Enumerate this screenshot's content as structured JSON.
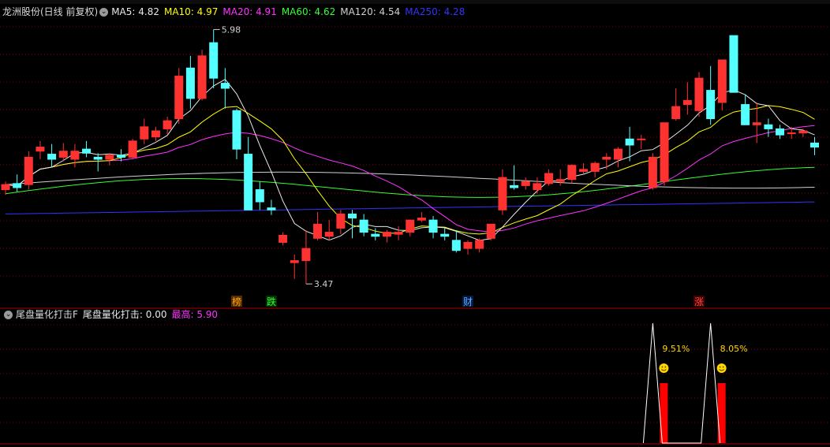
{
  "main": {
    "title": "龙洲股份(日线 前复权)",
    "ma_labels": [
      {
        "label": "MA5: 4.82",
        "color": "#e8e8e8"
      },
      {
        "label": "MA10: 4.97",
        "color": "#ffff00"
      },
      {
        "label": "MA20: 4.91",
        "color": "#ff33ff"
      },
      {
        "label": "MA60: 4.62",
        "color": "#33ff33"
      },
      {
        "label": "MA120: 4.54",
        "color": "#d0d0d0"
      },
      {
        "label": "MA250: 4.28",
        "color": "#3333ff"
      }
    ],
    "high_label": "5.98",
    "low_label": "3.47",
    "markers": [
      {
        "text": "榜",
        "color": "#ffaa00",
        "bg": "#5a2a00",
        "index": 20
      },
      {
        "text": "跌",
        "color": "#33ff33",
        "bg": "#003300",
        "index": 23
      },
      {
        "text": "财",
        "color": "#66aaff",
        "bg": "#001a44",
        "index": 40
      },
      {
        "text": "涨",
        "color": "#ff4444",
        "bg": "#440000",
        "index": 60
      }
    ]
  },
  "indicator": {
    "name": "尾盘量化打击F",
    "value_label": "尾盘量化打击: 0.00",
    "max_label": "最高: 5.90",
    "signals": [
      {
        "index": 56,
        "pct": "9.51%",
        "height": 5.9
      },
      {
        "index": 61,
        "pct": "8.05%",
        "height": 5.9
      }
    ]
  },
  "colors": {
    "up": "#ff3232",
    "down": "#54ffff",
    "bg": "#000000",
    "grid": "#8b0000"
  },
  "chart_data": {
    "type": "candlestick",
    "ylim": [
      3.3,
      6.1
    ],
    "candles": [
      [
        4.4,
        4.48,
        4.35,
        4.45
      ],
      [
        4.46,
        4.55,
        4.38,
        4.42
      ],
      [
        4.45,
        4.78,
        4.4,
        4.72
      ],
      [
        4.78,
        4.88,
        4.7,
        4.82
      ],
      [
        4.75,
        4.85,
        4.62,
        4.7
      ],
      [
        4.72,
        4.86,
        4.68,
        4.78
      ],
      [
        4.7,
        4.85,
        4.62,
        4.78
      ],
      [
        4.8,
        4.88,
        4.72,
        4.76
      ],
      [
        4.72,
        4.76,
        4.58,
        4.7
      ],
      [
        4.7,
        4.76,
        4.64,
        4.74
      ],
      [
        4.74,
        4.8,
        4.68,
        4.72
      ],
      [
        4.72,
        4.9,
        4.7,
        4.88
      ],
      [
        4.9,
        5.1,
        4.85,
        5.02
      ],
      [
        4.92,
        5.02,
        4.88,
        4.98
      ],
      [
        5.0,
        5.12,
        4.95,
        5.08
      ],
      [
        5.1,
        5.6,
        5.05,
        5.52
      ],
      [
        5.6,
        5.72,
        5.2,
        5.3
      ],
      [
        5.3,
        5.78,
        5.28,
        5.72
      ],
      [
        5.85,
        5.98,
        5.4,
        5.5
      ],
      [
        5.45,
        5.6,
        5.2,
        5.4
      ],
      [
        5.18,
        5.2,
        4.7,
        4.8
      ],
      [
        4.75,
        4.92,
        4.2,
        4.2
      ],
      [
        4.4,
        4.48,
        4.2,
        4.28
      ],
      [
        4.22,
        4.3,
        4.15,
        4.2
      ],
      [
        3.88,
        3.98,
        3.85,
        3.95
      ],
      [
        3.68,
        3.76,
        3.52,
        3.7
      ],
      [
        3.7,
        4.0,
        3.47,
        3.82
      ],
      [
        3.92,
        4.18,
        3.9,
        4.06
      ],
      [
        3.94,
        4.1,
        3.9,
        3.98
      ],
      [
        4.02,
        4.2,
        3.96,
        4.16
      ],
      [
        4.16,
        4.2,
        3.92,
        4.12
      ],
      [
        4.1,
        4.16,
        3.94,
        3.98
      ],
      [
        3.96,
        4.02,
        3.9,
        3.94
      ],
      [
        3.94,
        4.0,
        3.88,
        3.98
      ],
      [
        3.96,
        4.04,
        3.9,
        3.98
      ],
      [
        3.98,
        4.1,
        3.94,
        4.1
      ],
      [
        4.1,
        4.18,
        4.08,
        4.12
      ],
      [
        4.1,
        4.14,
        3.92,
        3.98
      ],
      [
        3.96,
        4.02,
        3.9,
        3.94
      ],
      [
        3.9,
        4.0,
        3.78,
        3.8
      ],
      [
        3.82,
        3.9,
        3.76,
        3.88
      ],
      [
        3.82,
        3.92,
        3.78,
        3.9
      ],
      [
        3.92,
        4.06,
        3.9,
        4.06
      ],
      [
        4.2,
        4.6,
        4.15,
        4.52
      ],
      [
        4.44,
        4.64,
        4.4,
        4.42
      ],
      [
        4.44,
        4.52,
        4.4,
        4.48
      ],
      [
        4.4,
        4.52,
        4.36,
        4.46
      ],
      [
        4.46,
        4.6,
        4.44,
        4.56
      ],
      [
        4.48,
        4.6,
        4.44,
        4.5
      ],
      [
        4.5,
        4.65,
        4.46,
        4.64
      ],
      [
        4.58,
        4.66,
        4.56,
        4.6
      ],
      [
        4.58,
        4.68,
        4.52,
        4.66
      ],
      [
        4.7,
        4.76,
        4.6,
        4.72
      ],
      [
        4.7,
        4.82,
        4.62,
        4.8
      ],
      [
        4.9,
        5.02,
        4.68,
        4.84
      ],
      [
        4.9,
        4.94,
        4.8,
        4.9
      ],
      [
        4.42,
        4.76,
        4.4,
        4.72
      ],
      [
        4.48,
        5.06,
        4.44,
        5.06
      ],
      [
        5.1,
        5.4,
        5.08,
        5.22
      ],
      [
        5.24,
        5.46,
        5.14,
        5.28
      ],
      [
        5.18,
        5.56,
        5.12,
        5.5
      ],
      [
        5.38,
        5.62,
        5.04,
        5.1
      ],
      [
        5.26,
        5.6,
        5.18,
        5.68
      ],
      [
        5.92,
        5.92,
        5.36,
        5.36
      ],
      [
        5.24,
        5.34,
        5.04,
        5.04
      ],
      [
        5.04,
        5.26,
        4.86,
        5.06
      ],
      [
        5.04,
        5.1,
        4.92,
        5.0
      ],
      [
        5.0,
        5.04,
        4.9,
        4.94
      ],
      [
        4.96,
        5.02,
        4.9,
        4.96
      ],
      [
        4.96,
        5.0,
        4.92,
        4.98
      ],
      [
        4.86,
        4.92,
        4.74,
        4.82
      ]
    ],
    "indicator_ylim": [
      0,
      5.9
    ]
  }
}
